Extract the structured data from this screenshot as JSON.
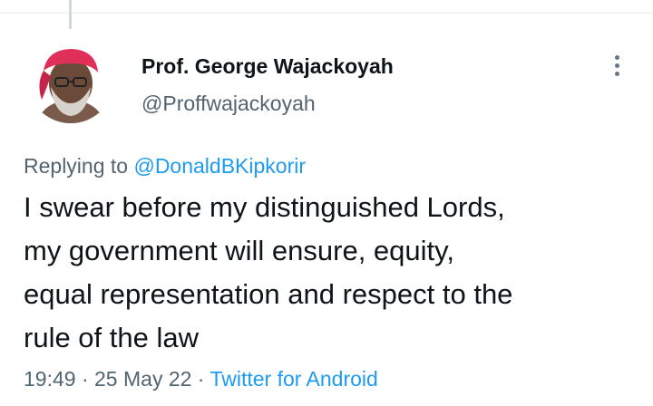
{
  "author": {
    "display_name": "Prof. George Wajackoyah",
    "handle": "@Proffwajackoyah",
    "avatar_icon": "profile-photo"
  },
  "reply": {
    "prefix": "Replying to ",
    "mention": "@DonaldBKipkorir"
  },
  "tweet": {
    "lines": [
      "I swear before my distinguished Lords,",
      "my government will ensure, equity,",
      "equal representation and respect to the",
      "rule of the law"
    ]
  },
  "meta": {
    "time": "19:49",
    "separator": " · ",
    "date": "25 May 22",
    "source": "Twitter for Android"
  },
  "icons": {
    "more": "more-vertical-icon"
  },
  "colors": {
    "text": "#0f1419",
    "secondary": "#536471",
    "link": "#1d9bf0",
    "headband": "#e0305a"
  }
}
